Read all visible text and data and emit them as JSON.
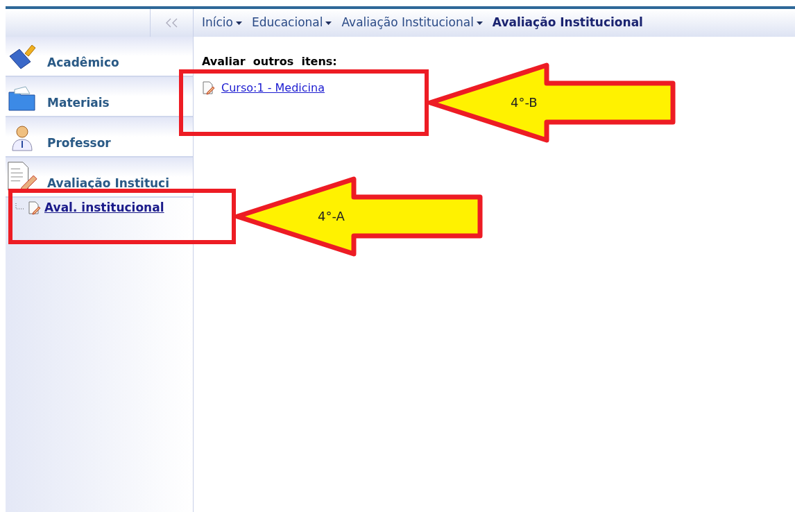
{
  "breadcrumb": [
    {
      "label": "Início",
      "kind": "dropdown"
    },
    {
      "label": "Educacional",
      "kind": "dropdown"
    },
    {
      "label": "Avaliação Institucional",
      "kind": "dropdown"
    },
    {
      "label": "Avaliação Institucional",
      "kind": "current"
    }
  ],
  "sidebar": {
    "items": [
      {
        "label": "Acadêmico",
        "kind": "brush"
      },
      {
        "label": "Materiais",
        "kind": "folder"
      },
      {
        "label": "Professor",
        "kind": "person"
      },
      {
        "label": "Avaliação Instituci",
        "kind": "document",
        "children": [
          {
            "label": "Aval. institucional",
            "selected": true
          }
        ]
      }
    ]
  },
  "content": {
    "heading": "Avaliar  outros  itens:",
    "links": [
      "Curso:1 - Medicina"
    ]
  },
  "annotations": [
    {
      "label": "4°-B",
      "kind": "arrow"
    },
    {
      "label": "4°-A",
      "kind": "arrow"
    }
  ]
}
